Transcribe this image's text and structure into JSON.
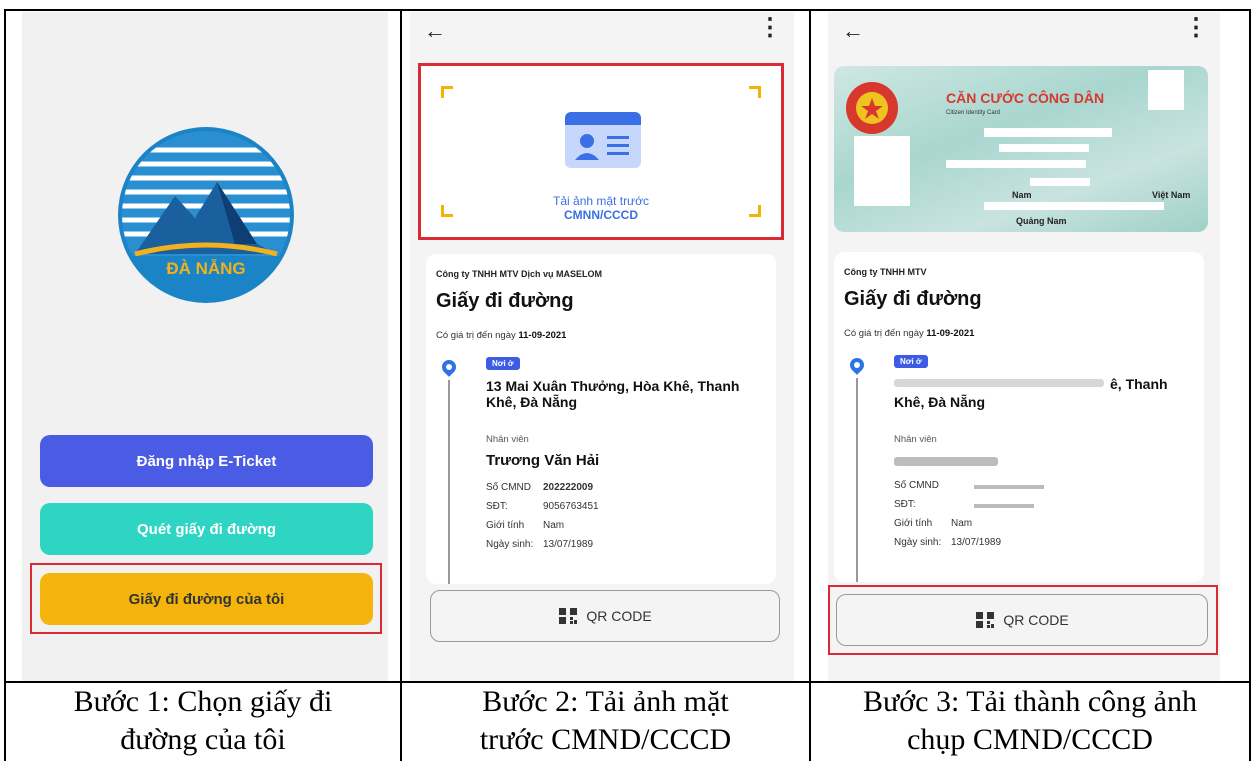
{
  "step1": {
    "logo_text": "ĐÀ NẴNG",
    "buttons": [
      {
        "label": "Đăng nhập E-Ticket",
        "color": "#4b5ce4"
      },
      {
        "label": "Quét giấy đi đường",
        "color": "#2fd5c3"
      },
      {
        "label": "Giấy đi đường của tôi",
        "color": "#f5b40b"
      }
    ],
    "caption_line1": "Bước 1: Chọn giấy đi",
    "caption_line2": "đường của tôi"
  },
  "step2": {
    "upload_label_line1": "Tải ảnh mặt trước",
    "upload_label_line2": "CMNN/CCCD",
    "company": "Công ty TNHH MTV Dịch vụ MASELOM",
    "title": "Giấy đi đường",
    "valid_prefix": "Có giá trị đến ngày",
    "valid_date": "11-09-2021",
    "tag": "Nơi ở",
    "address": "13 Mai Xuân Thưởng, Hòa Khê, Thanh Khê, Đà Nẵng",
    "employee_label": "Nhân viên",
    "employee_name": "Trương Văn Hải",
    "fields": [
      {
        "key": "Số CMND",
        "value": "202222009"
      },
      {
        "key": "SĐT:",
        "value": "9056763451"
      },
      {
        "key": "Giới tính",
        "value": "Nam"
      },
      {
        "key": "Ngày sinh:",
        "value": "13/07/1989"
      }
    ],
    "qr_label": "QR CODE",
    "caption_line1": "Bước 2: Tải ảnh mặt",
    "caption_line2": "trước CMND/CCCD"
  },
  "step3": {
    "id_card_title": "CĂN CƯỚC CÔNG DÂN",
    "id_card_subtitle": "Citizen Identity Card",
    "id_sex": "Nam",
    "id_nationality": "Việt Nam",
    "id_place": "Quảng Nam",
    "company": "Công ty TNHH MTV",
    "title": "Giấy đi đường",
    "valid_prefix": "Có giá trị đến ngày",
    "valid_date": "11-09-2021",
    "tag": "Nơi ở",
    "address_partial_1": "ê, Thanh",
    "address_partial_2": "Khê, Đà Nẵng",
    "employee_label": "Nhân viên",
    "field_labels": [
      "Số CMND",
      "SĐT:",
      "Giới tính",
      "Ngày sinh:"
    ],
    "gender": "Nam",
    "birth": "13/07/1989",
    "qr_label": "QR CODE",
    "caption_line1": "Bước 3: Tải thành công ảnh",
    "caption_line2": "chụp CMND/CCCD"
  },
  "icons": {
    "back": "←",
    "more": "⋮"
  }
}
